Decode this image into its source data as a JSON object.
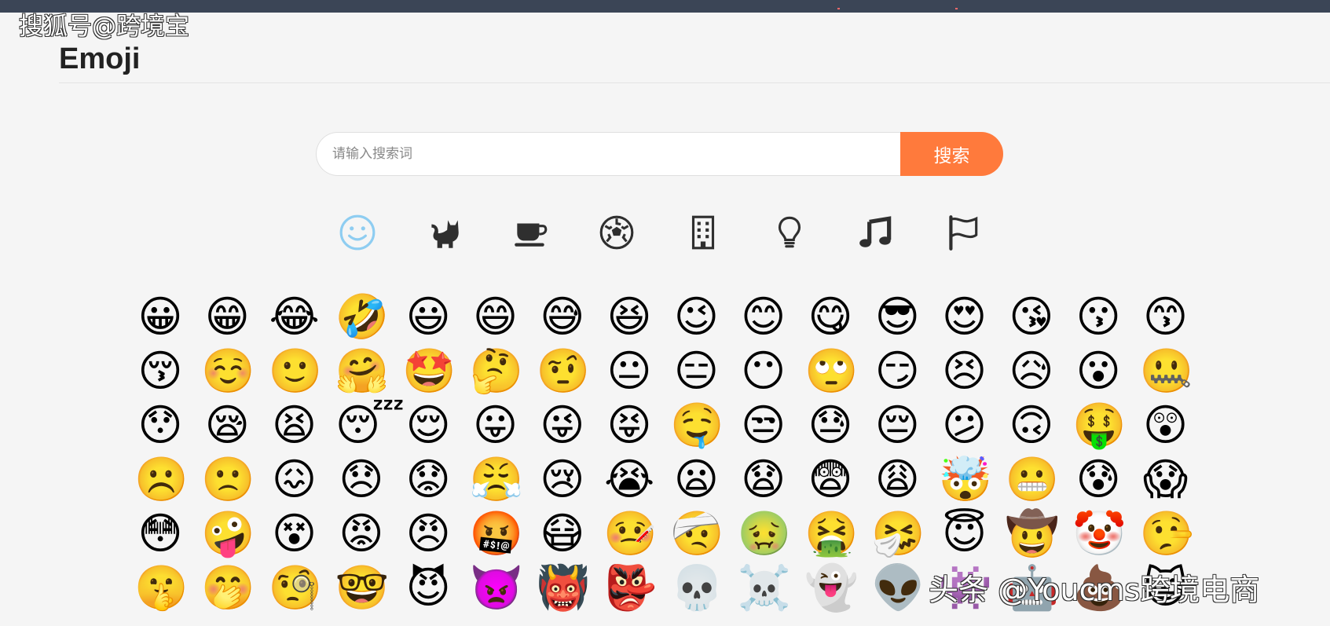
{
  "watermarks": {
    "top": "搜狐号@跨境宝",
    "bottom": "头条 @Youcms跨境电商"
  },
  "header": {
    "title": "Emoji"
  },
  "search": {
    "placeholder": "请输入搜索词",
    "button_label": "搜索"
  },
  "categories": [
    {
      "name": "smileys",
      "icon": "smiley-face-icon",
      "active": true
    },
    {
      "name": "animals",
      "icon": "cat-icon",
      "active": false
    },
    {
      "name": "food",
      "icon": "coffee-cup-icon",
      "active": false
    },
    {
      "name": "activities",
      "icon": "soccer-ball-icon",
      "active": false
    },
    {
      "name": "places",
      "icon": "building-icon",
      "active": false
    },
    {
      "name": "objects",
      "icon": "lightbulb-icon",
      "active": false
    },
    {
      "name": "symbols",
      "icon": "music-note-icon",
      "active": false
    },
    {
      "name": "flags",
      "icon": "flag-icon",
      "active": false
    }
  ],
  "colors": {
    "accent": "#ff7a3c",
    "active_category": "#8ecdf1",
    "category_icon": "#2f2f2f",
    "header_bar": "#3b4556",
    "background": "#f5f5f5"
  },
  "emoji_rows": [
    [
      "😀",
      "😁",
      "😂",
      "🤣",
      "😃",
      "😄",
      "😅",
      "😆",
      "😉",
      "😊",
      "😋",
      "😎",
      "😍",
      "😘",
      "😗",
      "😙"
    ],
    [
      "😚",
      "☺️",
      "🙂",
      "🤗",
      "🤩",
      "🤔",
      "🤨",
      "😐",
      "😑",
      "😶",
      "🙄",
      "😏",
      "😣",
      "😥",
      "😮",
      "🤐"
    ],
    [
      "😯",
      "😪",
      "😫",
      "😴",
      "😌",
      "😛",
      "😜",
      "😝",
      "🤤",
      "😒",
      "😓",
      "😔",
      "😕",
      "🙃",
      "🤑",
      "😲"
    ],
    [
      "☹️",
      "🙁",
      "😖",
      "😞",
      "😟",
      "😤",
      "😢",
      "😭",
      "😦",
      "😧",
      "😨",
      "😩",
      "🤯",
      "😬",
      "😰",
      "😱"
    ],
    [
      "😳",
      "🤪",
      "😵",
      "😡",
      "😠",
      "🤬",
      "😷",
      "🤒",
      "🤕",
      "🤢",
      "🤮",
      "🤧",
      "😇",
      "🤠",
      "🤡",
      "🤥"
    ],
    [
      "🤫",
      "🤭",
      "🧐",
      "🤓",
      "😈",
      "👿",
      "👹",
      "👺",
      "💀",
      "☠️",
      "👻",
      "👽",
      "👾",
      "🤖",
      "💩",
      "😺"
    ]
  ]
}
